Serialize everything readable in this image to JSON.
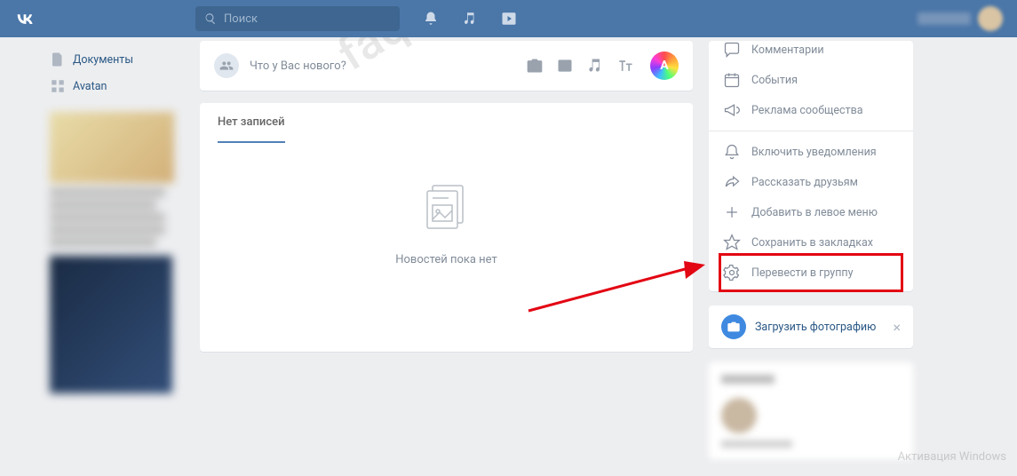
{
  "header": {
    "search_placeholder": "Поиск"
  },
  "sidebar": {
    "items": [
      {
        "label": "Документы"
      },
      {
        "label": "Avatan"
      }
    ]
  },
  "post": {
    "placeholder": "Что у Вас нового?",
    "user_badge": "А"
  },
  "feed": {
    "tab": "Нет записей",
    "empty": "Новостей пока нет"
  },
  "actions": {
    "comments": "Комментарии",
    "events": "События",
    "ads": "Реклама сообщества",
    "notify": "Включить уведомления",
    "share": "Рассказать друзьям",
    "add_left": "Добавить в левое меню",
    "bookmark": "Сохранить в закладках",
    "to_group": "Перевести в группу"
  },
  "upload": {
    "label": "Загрузить фотографию"
  },
  "watermark": "faqkontakt.ru",
  "winact": "Активация Windows"
}
